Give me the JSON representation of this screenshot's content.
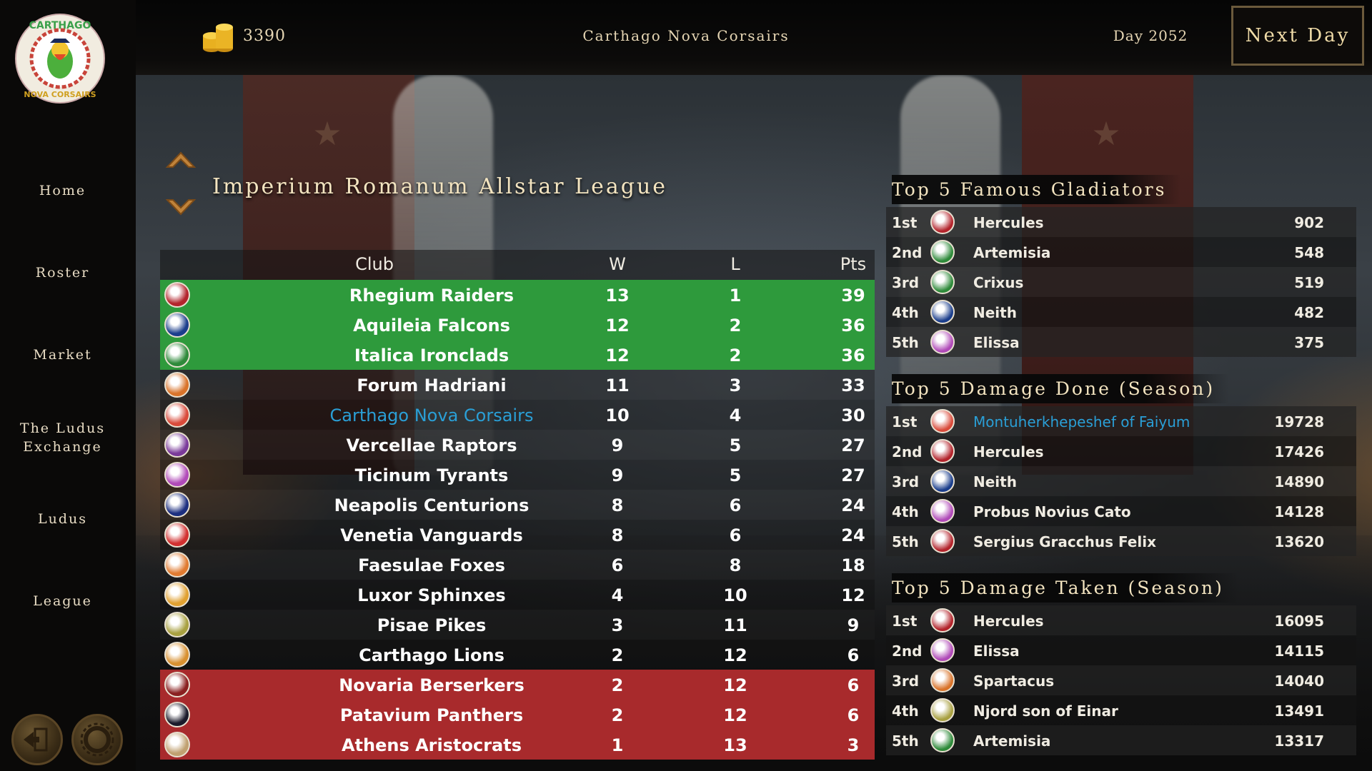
{
  "topbar": {
    "gold": "3390",
    "club_name": "Carthago Nova Corsairs",
    "day": "Day 2052",
    "next_day_label": "Next Day"
  },
  "logo": {
    "line1": "CARTHAGO",
    "line2": "NOVA CORSAIRS"
  },
  "sidebar": {
    "items": [
      {
        "label": "Home"
      },
      {
        "label": "Roster"
      },
      {
        "label": "Market"
      },
      {
        "label": "The Ludus Exchange"
      },
      {
        "label": "Ludus"
      },
      {
        "label": "League"
      }
    ],
    "bottom_icons": [
      "exit-door-icon",
      "settings-gear-icon"
    ]
  },
  "league": {
    "title": "Imperium Romanum Allstar League",
    "headers": {
      "club": "Club",
      "w": "W",
      "l": "L",
      "pts": "Pts"
    },
    "rows": [
      {
        "club": "Rhegium Raiders",
        "w": "13",
        "l": "1",
        "pts": "39",
        "zone": "promo",
        "color": "#b3242c"
      },
      {
        "club": "Aquileia Falcons",
        "w": "12",
        "l": "2",
        "pts": "36",
        "zone": "promo",
        "color": "#1b3e8c"
      },
      {
        "club": "Italica Ironclads",
        "w": "12",
        "l": "2",
        "pts": "36",
        "zone": "promo",
        "color": "#2e8a3a"
      },
      {
        "club": "Forum Hadriani",
        "w": "11",
        "l": "3",
        "pts": "33",
        "zone": "mid",
        "color": "#d9732a"
      },
      {
        "club": "Carthago Nova Corsairs",
        "w": "10",
        "l": "4",
        "pts": "30",
        "zone": "mid",
        "color": "#d94a3a",
        "highlight": true
      },
      {
        "club": "Vercellae Raptors",
        "w": "9",
        "l": "5",
        "pts": "27",
        "zone": "mid",
        "color": "#7a3a9a"
      },
      {
        "club": "Ticinum Tyrants",
        "w": "9",
        "l": "5",
        "pts": "27",
        "zone": "mid",
        "color": "#b04ab8"
      },
      {
        "club": "Neapolis Centurions",
        "w": "8",
        "l": "6",
        "pts": "24",
        "zone": "mid",
        "color": "#1c2f80"
      },
      {
        "club": "Venetia Vanguards",
        "w": "8",
        "l": "6",
        "pts": "24",
        "zone": "mid",
        "color": "#d23030"
      },
      {
        "club": "Faesulae Foxes",
        "w": "6",
        "l": "8",
        "pts": "18",
        "zone": "mid",
        "color": "#e07a30"
      },
      {
        "club": "Luxor Sphinxes",
        "w": "4",
        "l": "10",
        "pts": "12",
        "zone": "mid",
        "color": "#e0a030"
      },
      {
        "club": "Pisae Pikes",
        "w": "3",
        "l": "11",
        "pts": "9",
        "zone": "mid",
        "color": "#a8a040"
      },
      {
        "club": "Carthago Lions",
        "w": "2",
        "l": "12",
        "pts": "6",
        "zone": "mid",
        "color": "#d89030"
      },
      {
        "club": "Novaria Berserkers",
        "w": "2",
        "l": "12",
        "pts": "6",
        "zone": "releg",
        "color": "#8a2020"
      },
      {
        "club": "Patavium Panthers",
        "w": "2",
        "l": "12",
        "pts": "6",
        "zone": "releg",
        "color": "#1a1a2a"
      },
      {
        "club": "Athens Aristocrats",
        "w": "1",
        "l": "13",
        "pts": "3",
        "zone": "releg",
        "color": "#c0a070"
      }
    ]
  },
  "famous": {
    "title": "Top 5 Famous Gladiators",
    "rows": [
      {
        "rank": "1st",
        "name": "Hercules",
        "value": "902",
        "color": "#b3242c"
      },
      {
        "rank": "2nd",
        "name": "Artemisia",
        "value": "548",
        "color": "#2e8a3a"
      },
      {
        "rank": "3rd",
        "name": "Crixus",
        "value": "519",
        "color": "#2e8a3a"
      },
      {
        "rank": "4th",
        "name": "Neith",
        "value": "482",
        "color": "#1b3e8c"
      },
      {
        "rank": "5th",
        "name": "Elissa",
        "value": "375",
        "color": "#b04ab8"
      }
    ]
  },
  "damage_done": {
    "title": "Top 5 Damage Done (Season)",
    "rows": [
      {
        "rank": "1st",
        "name": "Montuherkhepeshef of Faiyum",
        "value": "19728",
        "color": "#d94a3a",
        "highlight": true
      },
      {
        "rank": "2nd",
        "name": "Hercules",
        "value": "17426",
        "color": "#b3242c"
      },
      {
        "rank": "3rd",
        "name": "Neith",
        "value": "14890",
        "color": "#1b3e8c"
      },
      {
        "rank": "4th",
        "name": "Probus Novius Cato",
        "value": "14128",
        "color": "#b04ab8"
      },
      {
        "rank": "5th",
        "name": "Sergius Gracchus Felix",
        "value": "13620",
        "color": "#b3242c"
      }
    ]
  },
  "damage_taken": {
    "title": "Top 5 Damage Taken (Season)",
    "rows": [
      {
        "rank": "1st",
        "name": "Hercules",
        "value": "16095",
        "color": "#b3242c"
      },
      {
        "rank": "2nd",
        "name": "Elissa",
        "value": "14115",
        "color": "#b04ab8"
      },
      {
        "rank": "3rd",
        "name": "Spartacus",
        "value": "14040",
        "color": "#d9732a"
      },
      {
        "rank": "4th",
        "name": "Njord son of Einar",
        "value": "13491",
        "color": "#a8a040"
      },
      {
        "rank": "5th",
        "name": "Artemisia",
        "value": "13317",
        "color": "#2e8a3a"
      }
    ]
  }
}
